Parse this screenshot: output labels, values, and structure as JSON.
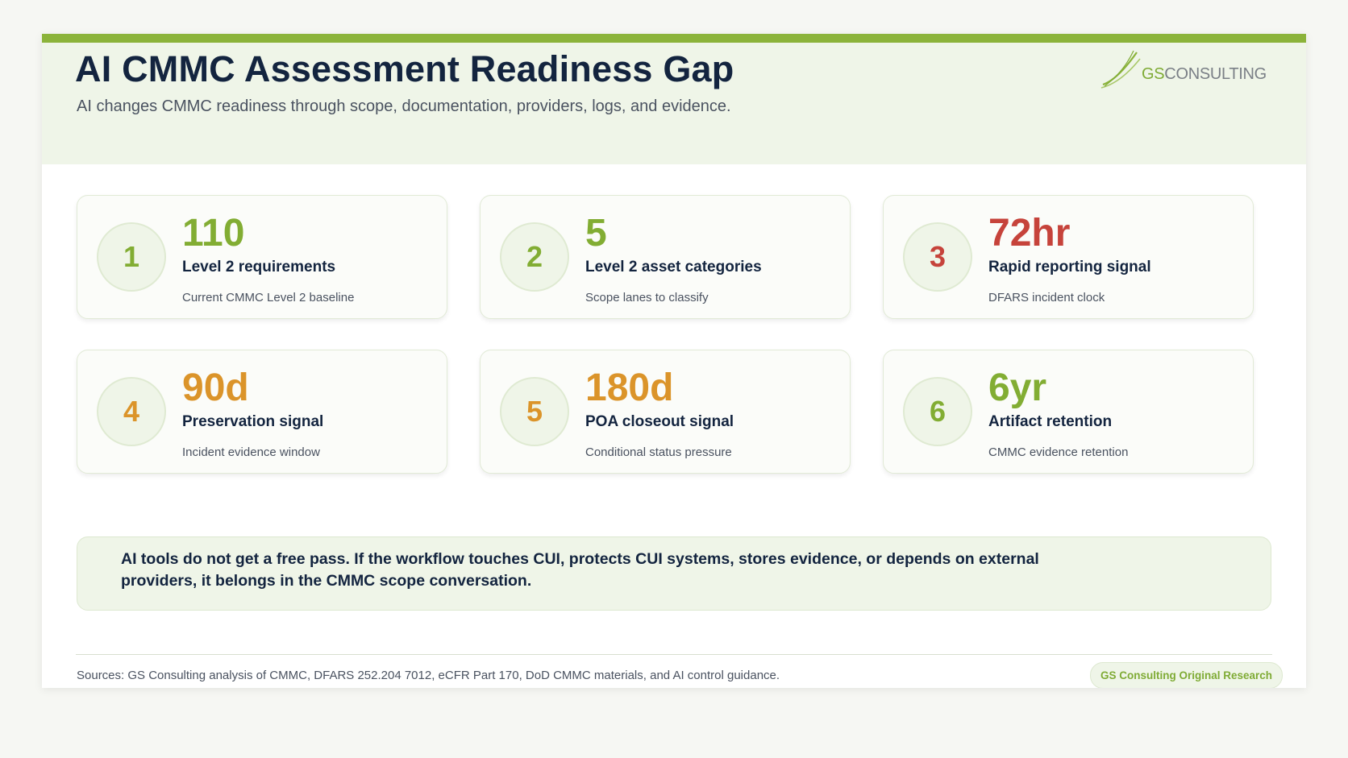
{
  "header": {
    "title": "AI CMMC Assessment Readiness Gap",
    "subtitle": "AI changes CMMC readiness through scope, documentation, providers, logs, and evidence.",
    "logo": {
      "prefix": "GS",
      "suffix": "CONSULTING",
      "icon": "swoosh-icon"
    }
  },
  "colors": {
    "accent": "#8bb33a",
    "green": "#82ad33",
    "red": "#c6433b",
    "orange": "#db942a",
    "navy": "#13243f"
  },
  "stats": [
    {
      "number": "1",
      "value": "110",
      "label": "Level 2 requirements",
      "sub": "Current CMMC Level 2 baseline",
      "tone": "green"
    },
    {
      "number": "2",
      "value": "5",
      "label": "Level 2 asset categories",
      "sub": "Scope lanes to classify",
      "tone": "green"
    },
    {
      "number": "3",
      "value": "72hr",
      "label": "Rapid reporting signal",
      "sub": "DFARS incident clock",
      "tone": "red"
    },
    {
      "number": "4",
      "value": "90d",
      "label": "Preservation signal",
      "sub": "Incident evidence window",
      "tone": "orange"
    },
    {
      "number": "5",
      "value": "180d",
      "label": "POA closeout signal",
      "sub": "Conditional status pressure",
      "tone": "orange"
    },
    {
      "number": "6",
      "value": "6yr",
      "label": "Artifact retention",
      "sub": "CMMC evidence retention",
      "tone": "green"
    }
  ],
  "note": "AI tools do not get a free pass. If the workflow touches CUI, protects CUI systems, stores evidence, or depends on external providers, it belongs in the CMMC scope conversation.",
  "footer": {
    "sources": "Sources: GS Consulting analysis of CMMC, DFARS 252.204 7012, eCFR Part 170, DoD CMMC materials, and AI control guidance.",
    "badge": "GS Consulting Original Research"
  }
}
